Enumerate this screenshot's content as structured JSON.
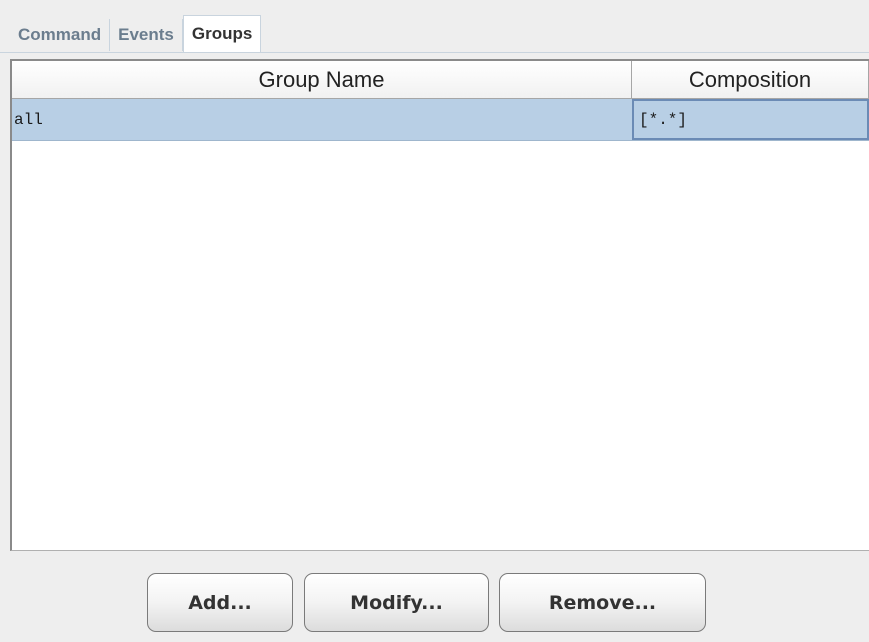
{
  "tabs": [
    {
      "label": "Command",
      "selected": false
    },
    {
      "label": "Events",
      "selected": false
    },
    {
      "label": "Groups",
      "selected": true
    }
  ],
  "table": {
    "columns": [
      "Group Name",
      "Composition"
    ],
    "rows": [
      {
        "group_name": "all",
        "composition": "[*.*]"
      }
    ]
  },
  "buttons": {
    "add": "Add...",
    "modify": "Modify...",
    "remove": "Remove..."
  },
  "colors": {
    "selection_row": "#b8cfe5",
    "panel_background": "#eeeeee",
    "table_background": "#ffffff",
    "tab_inactive_text": "#6b7d8e"
  }
}
